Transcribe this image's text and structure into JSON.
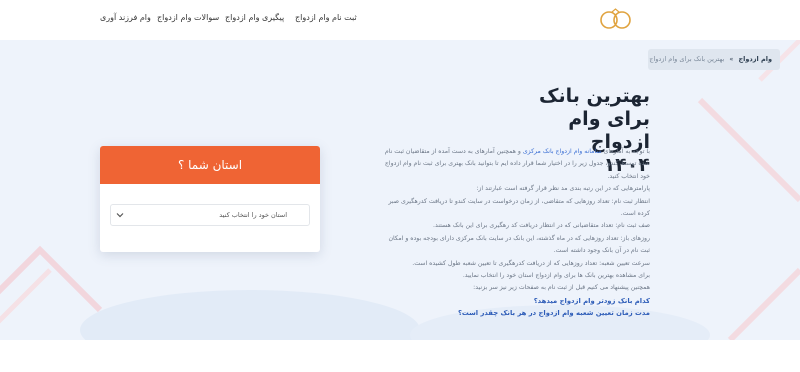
{
  "header": {
    "logo_icon": "ring-logo-icon",
    "brand_color": "#e0a33f",
    "nav": [
      {
        "label": "ثبت نام وام ازدواج"
      },
      {
        "label": "پیگیری وام ازدواج"
      },
      {
        "label": "سوالات وام ازدواج"
      },
      {
        "label": "وام فرزند آوری"
      }
    ]
  },
  "breadcrumb": {
    "home": "وام ازدواج",
    "separator": "»",
    "current": "بهترین بانک برای وام ازدواج ۱۴۰۴"
  },
  "main": {
    "title_line1": "بهترین بانک برای وام ازدواج",
    "title_line2": "۱۴۰۴",
    "paragraph": {
      "part1": "با توجه به آمارهای ",
      "link1": "سامانه وام ازدواج بانک مرکزی",
      "part2": " و همچنین آمارهای به دست آمده از متقاضیان ثبت نام شده توسط کندو، جدول زیر را در اختیار شما قرار داده ایم تا بتوانید بانک بهتری برای ثبت نام وام ازدواج خود انتخاب کنید."
    },
    "lines": [
      "پارامترهایی که در این رتبه بندی مد نظر قرار گرفته است عبارتند از:",
      "انتظار ثبت نام: تعداد روزهایی که متقاضی، از زمان درخواست در سایت کندو تا دریافت کدرهگیری صبر کرده است.",
      "صف ثبت نام: تعداد متقاضیانی که در انتظار دریافت کد رهگیری برای این بانک هستند.",
      "روزهای باز: تعداد روزهایی که در ماه گذشته، این بانک در سایت بانک مرکزی دارای بودجه بوده و امکان ثبت نام در آن بانک وجود داشته است.",
      "سرعت تعیین شعبه: تعداد روزهایی که از دریافت کدرهگیری تا تعیین شعبه طول کشیده است.",
      "برای مشاهده بهترین بانک ها برای وام ازدواج استان خود را انتخاب نمایید.",
      "همچنین پیشنهاد می کنیم قبل از ثبت نام به صفحات زیر نیز سر بزنید:"
    ],
    "links": [
      "کدام بانک زودتر وام ازدواج میدهد؟",
      "مدت زمان تعیین شعبه وام ازدواج در هر بانک چقدر است؟"
    ]
  },
  "province_card": {
    "title": "استان شما ؟",
    "header_color": "#ef6434",
    "select_value": "استان خود را انتخاب کنید",
    "chevron_icon": "chevron-down-icon"
  }
}
